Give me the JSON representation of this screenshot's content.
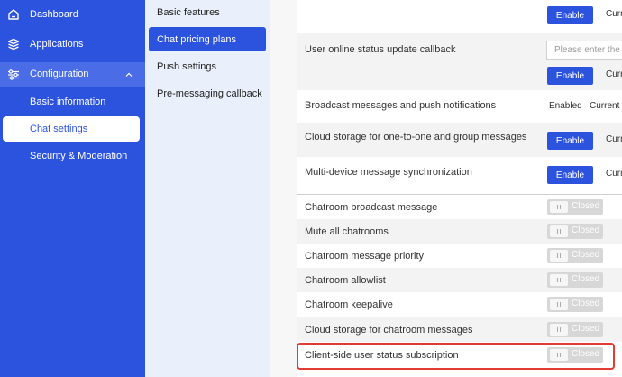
{
  "sidebar": {
    "dashboard": "Dashboard",
    "applications": "Applications",
    "configuration": "Configuration",
    "sub_items": [
      "Basic information",
      "Chat settings",
      "Security & Moderation"
    ]
  },
  "subnav": {
    "items": [
      "Basic features",
      "Chat pricing plans",
      "Push settings",
      "Pre-messaging callback"
    ]
  },
  "content": {
    "top_enable": "Enable",
    "top_current": "Curre",
    "rows": [
      {
        "label": "User online status update callback",
        "placeholder": "Please enter the",
        "button": "Enable",
        "current": "Curr"
      },
      {
        "label": "Broadcast messages and push notifications",
        "status": "Enabled",
        "current": "Current"
      },
      {
        "label": "Cloud storage for one-to-one and group messages",
        "button": "Enable",
        "current": "Curr"
      },
      {
        "label": "Multi-device message synchronization",
        "button": "Enable",
        "current": "Curr"
      }
    ],
    "toggles": [
      {
        "label": "Chatroom broadcast message",
        "state": "Closed"
      },
      {
        "label": "Mute all chatrooms",
        "state": "Closed"
      },
      {
        "label": "Chatroom message priority",
        "state": "Closed"
      },
      {
        "label": "Chatroom allowlist",
        "state": "Closed"
      },
      {
        "label": "Chatroom keepalive",
        "state": "Closed"
      },
      {
        "label": "Cloud storage for chatroom messages",
        "state": "Closed"
      },
      {
        "label": "Client-side user status subscription",
        "state": "Closed"
      }
    ]
  },
  "colors": {
    "brand": "#2c53de",
    "highlight": "#e23b33",
    "toggle_off": "#d7d7d7"
  },
  "icons": [
    "home-icon",
    "cube-icon",
    "sliders-icon",
    "chevron-up-icon"
  ]
}
